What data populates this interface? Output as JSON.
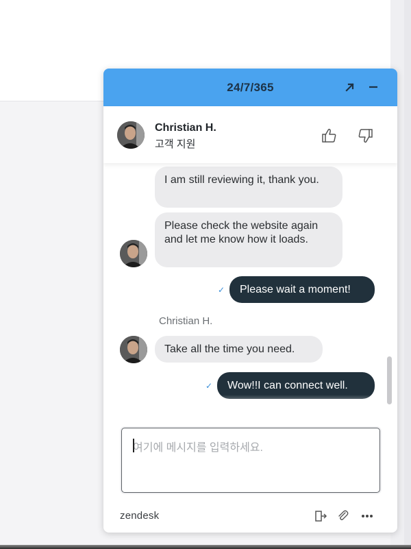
{
  "widget": {
    "title": "24/7/365"
  },
  "agent": {
    "name": "Christian H.",
    "role": "고객 지원"
  },
  "messages": [
    {
      "from": "agent",
      "text": "I am still reviewing it, thank you."
    },
    {
      "from": "agent",
      "text": "Please check the website again and let me know how it loads."
    },
    {
      "from": "visitor",
      "text": "Please wait a moment!"
    },
    {
      "from": "agent-label",
      "text": "Christian H."
    },
    {
      "from": "agent",
      "text": "Take all the time you need."
    },
    {
      "from": "visitor",
      "text": "Wow!!I can connect well."
    }
  ],
  "input": {
    "placeholder": "여기에 메시지를 입력하세요.",
    "value": ""
  },
  "footer": {
    "brand": "zendesk"
  },
  "icons": {
    "header_expand": "expand-arrow-icon",
    "header_minimize": "minimize-icon",
    "rate_good": "thumbs-up-icon",
    "rate_bad": "thumbs-down-icon",
    "delivered": "check-icon",
    "end_chat": "exit-door-icon",
    "attach": "paperclip-icon",
    "more": "more-dots-icon"
  },
  "colors": {
    "header_bg": "#4aa3ef",
    "header_text": "#1d3245",
    "visitor_bubble": "#21313c",
    "agent_bubble": "#ebebed",
    "delivered_check": "#3b8fd9"
  }
}
